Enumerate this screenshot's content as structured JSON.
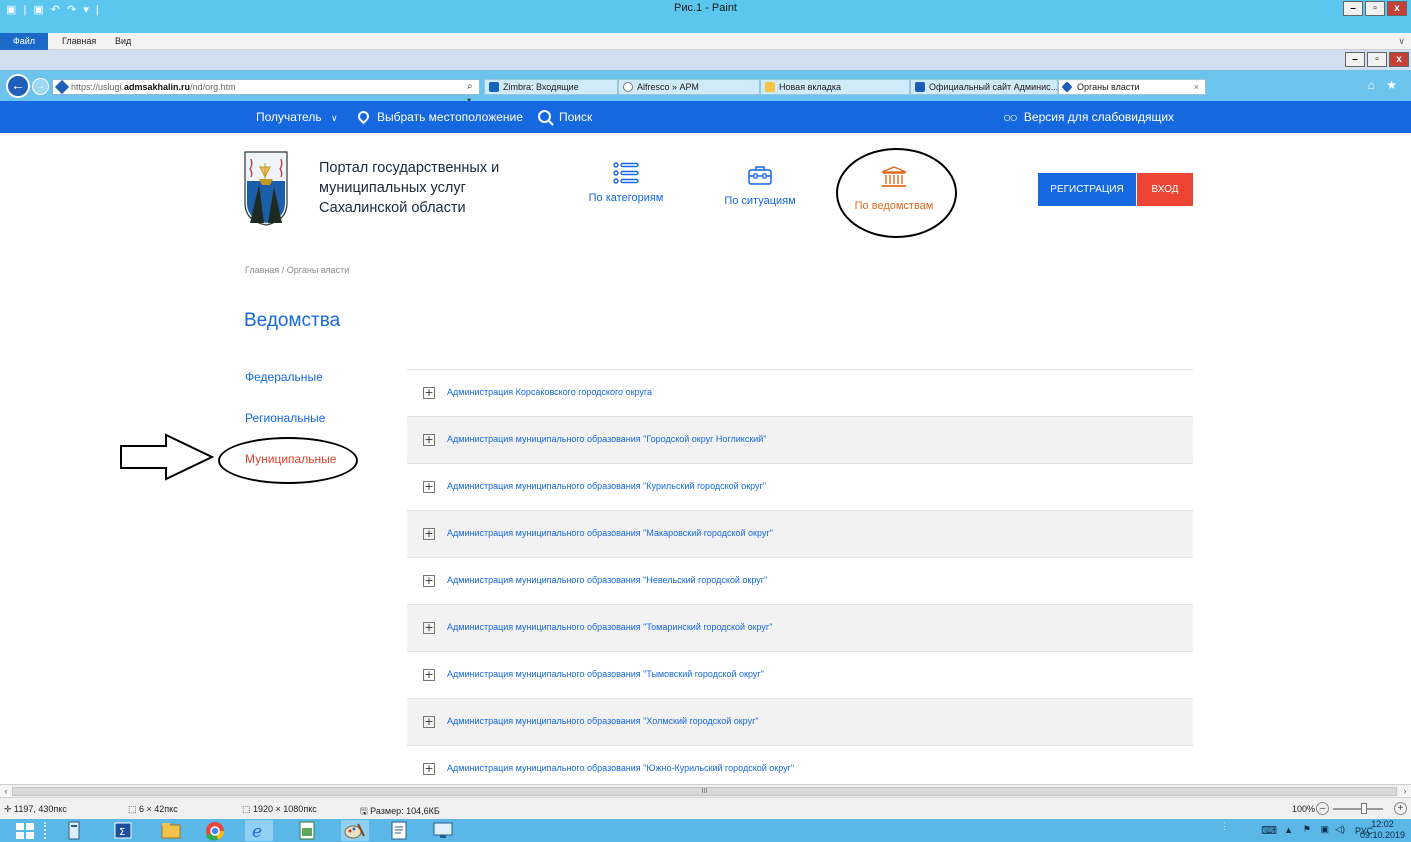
{
  "paint": {
    "title": "Рис.1 - Paint",
    "ribbon_tabs": [
      "Файл",
      "Главная",
      "Вид"
    ],
    "status": {
      "cursor": "1197, 430пкс",
      "selection": "6 × 42пкс",
      "image_size": "1920 × 1080пкс",
      "file_size": "Размер: 104,6КБ",
      "zoom": "100%"
    }
  },
  "browser": {
    "url_prefix": "https://uslugi.",
    "url_host": "admsakhalin.ru",
    "url_path": "/nd/org.htm",
    "tabs": [
      {
        "label": "Zimbra: Входящие",
        "icon_color": "#1565c0"
      },
      {
        "label": "Alfresco » АРМ",
        "icon_color": "#ffffff"
      },
      {
        "label": "Новая вкладка",
        "icon_color": "#f6c343"
      },
      {
        "label": "Официальный сайт Админис...",
        "icon_color": "#1f5fb8"
      },
      {
        "label": "Органы власти",
        "icon_color": "#1f5fb8",
        "active": true
      }
    ]
  },
  "site_nav": {
    "recipient": "Получатель",
    "location": "Выбрать местоположение",
    "search": "Поиск",
    "accessibility": "Версия для слабовидящих"
  },
  "header": {
    "portal_title_lines": [
      "Портал государственных и",
      "муниципальных услуг",
      "Сахалинской области"
    ],
    "nav": [
      {
        "label": "По категориям",
        "icon": "list-icon",
        "color": "#1668e0"
      },
      {
        "label": "По ситуациям",
        "icon": "briefcase-icon",
        "color": "#1668e0"
      },
      {
        "label": "По ведомствам",
        "icon": "building-icon",
        "color": "#e36a1c"
      }
    ],
    "register": "Регистрация",
    "login": "Вход"
  },
  "breadcrumb": "Главная / Органы власти",
  "page_title": "Ведомства",
  "sidebar": {
    "links": [
      {
        "label": "Федеральные"
      },
      {
        "label": "Региональные"
      },
      {
        "label": "Муниципальные",
        "active": true
      }
    ]
  },
  "orgs": [
    "Администрация Корсаковского городского округа",
    "Администрация муниципального образования \"Городской округ Ногликский\"",
    "Администрация муниципального образования \"Курильский городской округ\"",
    "Администрация муниципального образования \"Макаровский городской округ\"",
    "Администрация муниципального образования \"Невельский городской округ\"",
    "Администрация муниципального образования \"Томаринский городской округ\"",
    "Администрация муниципального образования \"Тымовский городской округ\"",
    "Администрация муниципального образования \"Холмский городской округ\"",
    "Администрация муниципального образования \"Южно-Курильский городской округ\""
  ],
  "taskbar": {
    "lang": "РУС",
    "time": "12:02",
    "date": "09.10.2019"
  },
  "colors": {
    "brand_blue": "#1668e0",
    "login_red": "#ee4433",
    "active_orange": "#e36a1c",
    "active_red": "#e7412b"
  }
}
